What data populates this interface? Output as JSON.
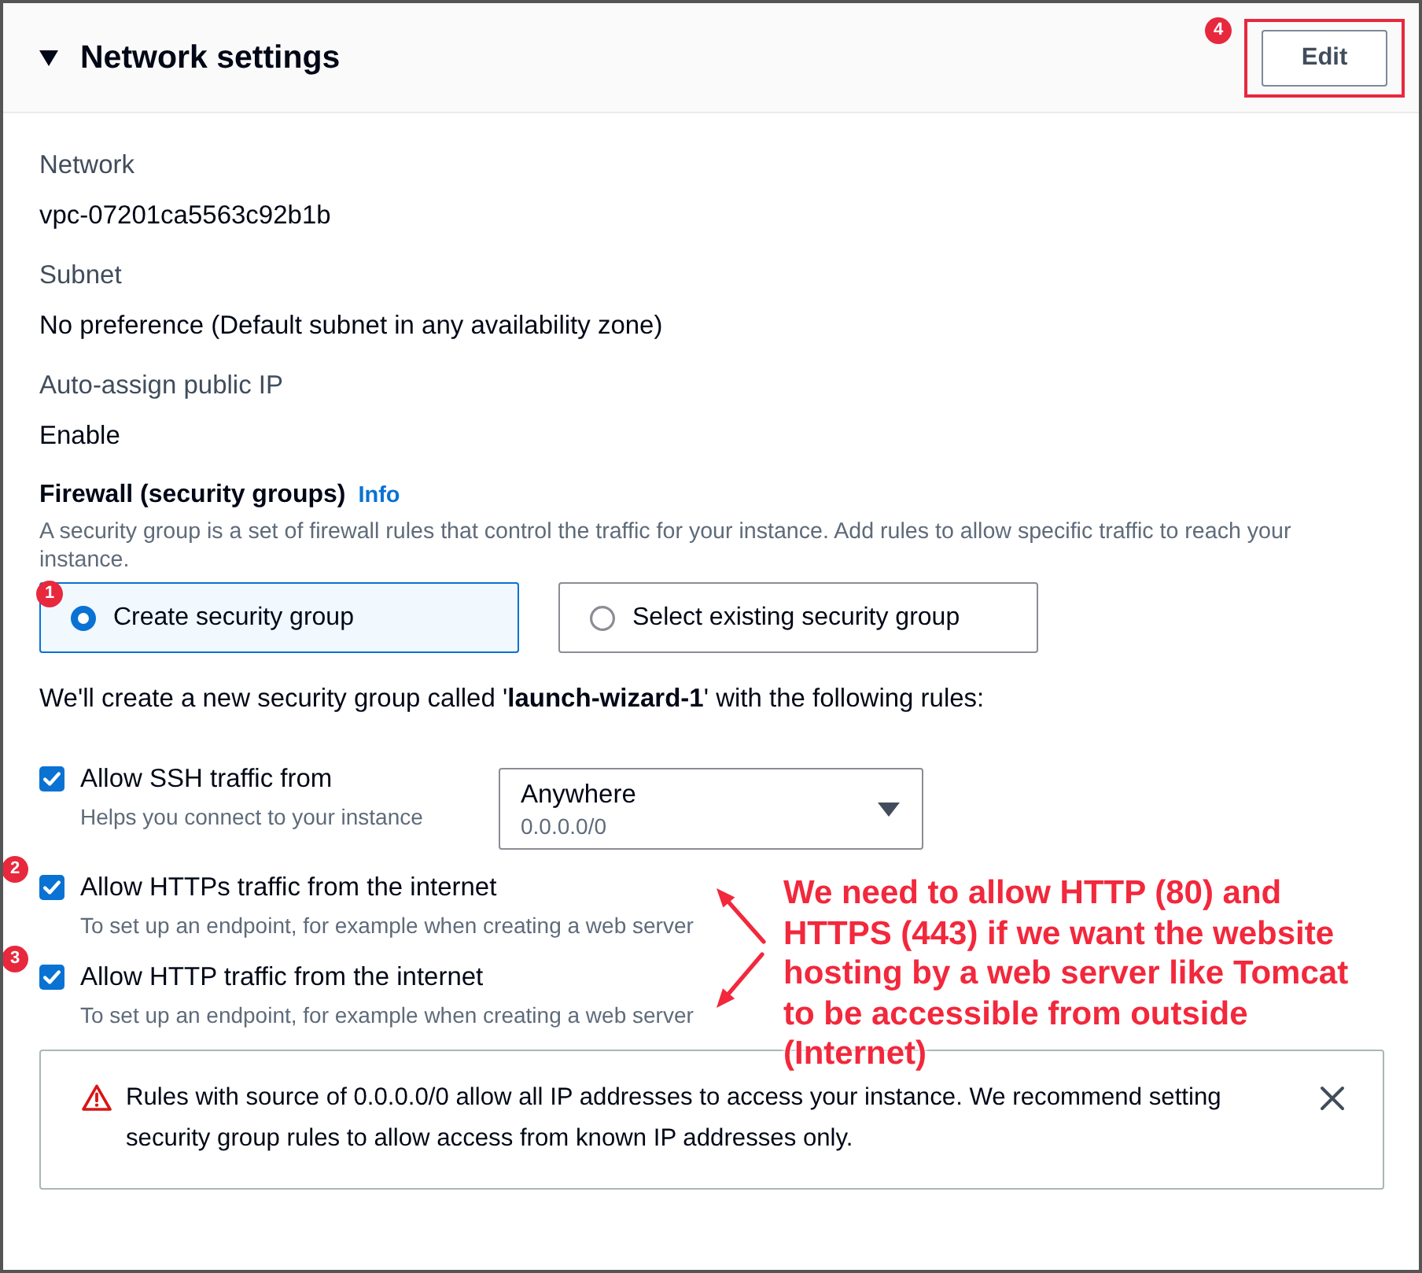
{
  "panel": {
    "title": "Network settings",
    "expanded": true,
    "edit_button": {
      "label": "Edit",
      "highlighted": true,
      "marker": "4"
    }
  },
  "fields": [
    {
      "label": "Network",
      "value": "vpc-07201ca5563c92b1b"
    },
    {
      "label": "Subnet",
      "value": "No preference (Default subnet in any availability zone)"
    },
    {
      "label": "Auto-assign public IP",
      "value": "Enable"
    }
  ],
  "firewall": {
    "label": "Firewall (security groups)",
    "info_link": "Info",
    "description": "A security group is a set of firewall rules that control the traffic for your instance. Add rules to allow specific traffic to reach your instance.",
    "options": [
      {
        "label": "Create security group",
        "selected": true,
        "marker": "1"
      },
      {
        "label": "Select existing security group",
        "selected": false
      }
    ],
    "rules_intro": "We'll create a new security group called '**launch-wizard-1**' with the following rules:",
    "rules": [
      {
        "kind": "select",
        "label": "Allow SSH traffic from",
        "hint": "Helps you connect to your instance",
        "checked": true,
        "source": {
          "value": "Anywhere",
          "detail": "0.0.0.0/0"
        }
      },
      {
        "kind": "plain",
        "label": "Allow HTTPs traffic from the internet",
        "hint": "To set up an endpoint, for example when creating a web server",
        "checked": true,
        "marker": "2"
      },
      {
        "kind": "plain",
        "label": "Allow HTTP traffic from the internet",
        "hint": "To set up an endpoint, for example when creating a web server",
        "checked": true,
        "marker": "3"
      }
    ],
    "alert": {
      "text": "Rules with source of 0.0.0.0/0 allow all IP addresses to access your instance. We recommend setting security group rules to allow access from known IP addresses only."
    }
  },
  "annotation": {
    "note": "We need to allow HTTP (80) and HTTPS (443) if we want the website hosting by a web server like Tomcat to be accessible from outside (Internet)"
  }
}
